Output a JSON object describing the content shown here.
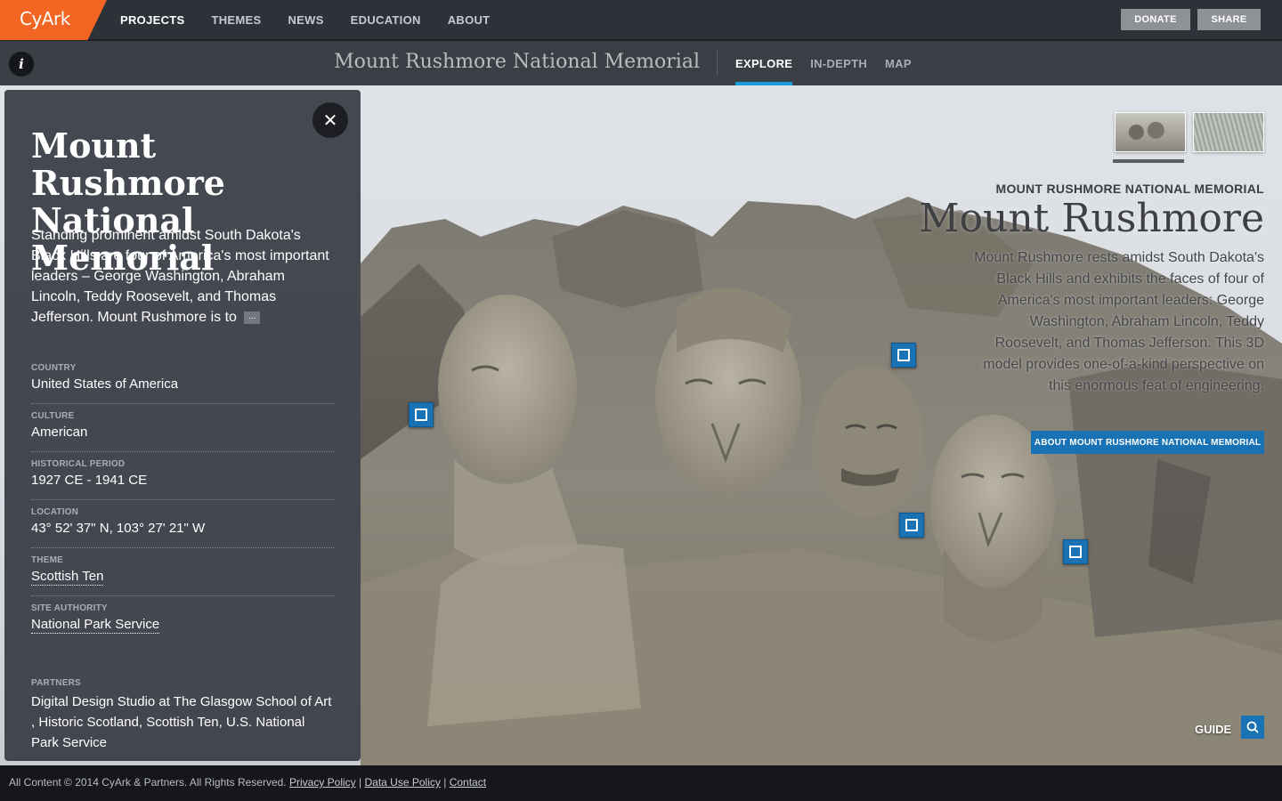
{
  "brand": {
    "logo_text": "CyArk",
    "accent_color": "#f26522"
  },
  "nav": {
    "items": [
      {
        "label": "PROJECTS",
        "active": true
      },
      {
        "label": "THEMES"
      },
      {
        "label": "NEWS"
      },
      {
        "label": "EDUCATION"
      },
      {
        "label": "ABOUT"
      }
    ],
    "donate_label": "DONATE",
    "share_label": "SHARE"
  },
  "subnav": {
    "info_icon": "i",
    "title": "Mount Rushmore National Memorial",
    "tabs": [
      {
        "label": "EXPLORE",
        "active": true
      },
      {
        "label": "IN-DEPTH"
      },
      {
        "label": "MAP"
      }
    ],
    "active_color": "#1a9bd7"
  },
  "panel": {
    "close_icon": "✕",
    "title": "Mount Rushmore National Memorial",
    "description": "Standing prominent amidst South Dakota's Black Hills are four of America's most important leaders – George Washington, Abraham Lincoln, Teddy Roosevelt, and Thomas Jefferson. Mount Rushmore is to",
    "more_icon": "...",
    "fields": [
      {
        "label": "COUNTRY",
        "value": "United States of America"
      },
      {
        "label": "CULTURE",
        "value": "American"
      },
      {
        "label": "HISTORICAL PERIOD",
        "value": "1927 CE - 1941 CE"
      },
      {
        "label": "LOCATION",
        "value": "43° 52' 37\" N, 103° 27' 21\" W"
      },
      {
        "label": "THEME",
        "value": "Scottish Ten"
      },
      {
        "label": "SITE AUTHORITY",
        "value": "National Park Service"
      }
    ],
    "partners": {
      "label": "PARTNERS",
      "value": "Digital Design Studio at The Glasgow School of Art , Historic Scotland, Scottish Ten, U.S. National Park Service"
    }
  },
  "viewer": {
    "project_label": "MOUNT RUSHMORE NATIONAL MEMORIAL",
    "project_name": "Mount Rushmore",
    "project_description": "Mount Rushmore rests amidst South Dakota's Black Hills and exhibits the faces of four of America's most important leaders: George Washington, Abraham Lincoln, Teddy Roosevelt, and Thomas Jefferson. This 3D model provides one-of-a-kind perspective on this enormous feat of engineering.",
    "about_button": "ABOUT MOUNT RUSHMORE NATIONAL MEMORIAL",
    "guide_label": "GUIDE",
    "hotspot_icon": "image-icon",
    "link_color": "#1872b4"
  },
  "footer": {
    "copyright": "All Content © 2014 CyArk & Partners. All Rights Reserved.",
    "links": [
      "Privacy Policy",
      "Data Use Policy",
      "Contact"
    ],
    "separator": "|"
  }
}
